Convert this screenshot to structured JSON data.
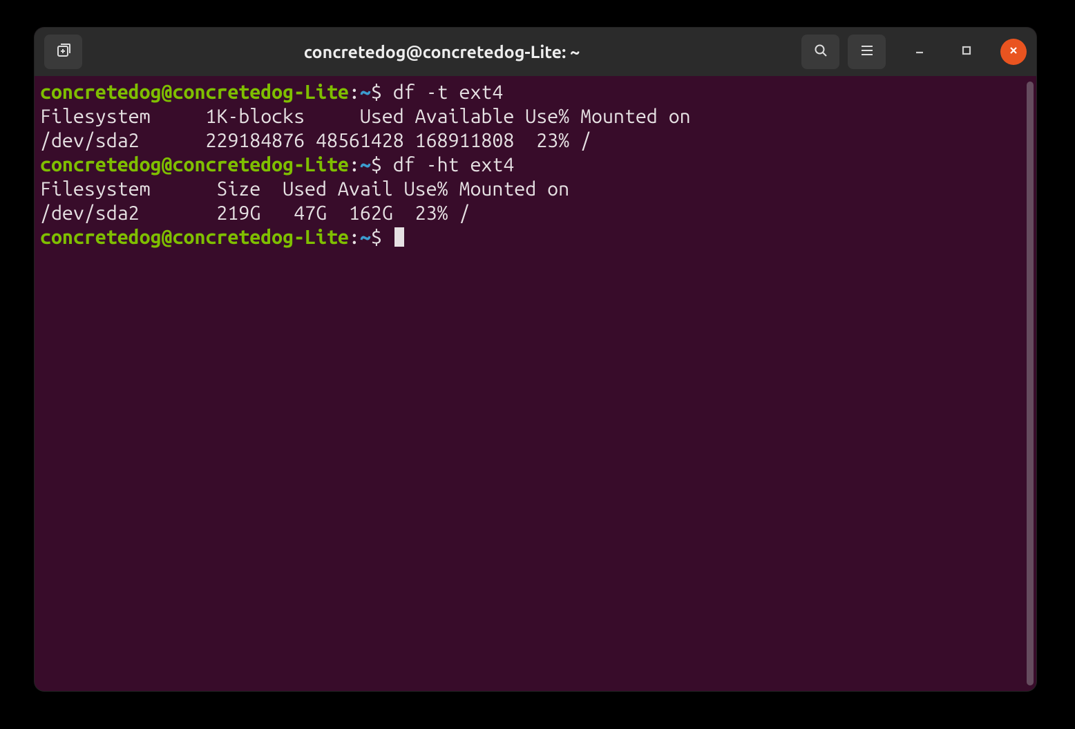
{
  "window": {
    "title": "concretedog@concretedog-Lite: ~"
  },
  "prompt": {
    "user_host": "concretedog@concretedog-Lite",
    "colon": ":",
    "path": "~",
    "dollar": "$"
  },
  "lines": {
    "cmd1": " df -t ext4",
    "out1a": "Filesystem     1K-blocks     Used Available Use% Mounted on",
    "out1b": "/dev/sda2      229184876 48561428 168911808  23% /",
    "cmd2": " df -ht ext4",
    "out2a": "Filesystem      Size  Used Avail Use% Mounted on",
    "out2b": "/dev/sda2       219G   47G  162G  23% /",
    "cmd3": " "
  },
  "colors": {
    "bg": "#380C2A",
    "titlebar": "#2B2B2B",
    "prompt_user": "#7FBF00",
    "prompt_path": "#3C9DD0",
    "text": "#E6E1E3",
    "close_btn": "#E95420"
  },
  "icons": {
    "new_tab": "new-tab-icon",
    "search": "search-icon",
    "menu": "hamburger-icon",
    "minimize": "minimize-icon",
    "maximize": "maximize-icon",
    "close": "close-icon"
  }
}
